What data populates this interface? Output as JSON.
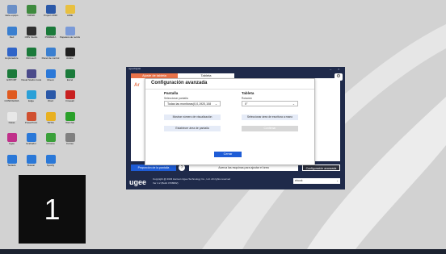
{
  "desktop": {
    "icons": [
      {
        "label": "Este equipo",
        "color": "#6a8fc7"
      },
      {
        "label": "XMIND",
        "color": "#3e8a3e"
      },
      {
        "label": "Project 2020",
        "color": "#2a58a8"
      },
      {
        "label": "AIDE",
        "color": "#e8c040"
      },
      {
        "label": "Red",
        "color": "#3a7fd0"
      },
      {
        "label": "OBS Studio",
        "color": "#303030"
      },
      {
        "label": "PRIMERA",
        "color": "#1a7a3a"
      },
      {
        "label": "Papelera de reciclaje",
        "color": "#7a9ad8"
      },
      {
        "label": "Exploradore",
        "color": "#2f64c8"
      },
      {
        "label": "Microsoft",
        "color": "#1a7a3a"
      },
      {
        "label": "Panel de control",
        "color": "#3a7fd0"
      },
      {
        "label": "Adobe",
        "color": "#202020"
      },
      {
        "label": "EXPORT",
        "color": "#1a7a3a"
      },
      {
        "label": "Visual Studio Code",
        "color": "#4a4a8a"
      },
      {
        "label": "Ubeon",
        "color": "#2a78d8"
      },
      {
        "label": "Excel",
        "color": "#1a7a3a"
      },
      {
        "label": "CONFIGURA",
        "color": "#e05a20"
      },
      {
        "label": "Edge",
        "color": "#2aa0d8"
      },
      {
        "label": "Word",
        "color": "#2a58a8"
      },
      {
        "label": "Firewall",
        "color": "#c82020"
      },
      {
        "label": "Notas",
        "color": "#e8e8e8"
      },
      {
        "label": "PowerPoint",
        "color": "#d05030"
      },
      {
        "label": "TikTok",
        "color": "#e8b020"
      },
      {
        "label": "WeChat",
        "color": "#2aa02a"
      },
      {
        "label": "Ugee",
        "color": "#c0308a"
      },
      {
        "label": "Grabador",
        "color": "#2a78d8"
      },
      {
        "label": "Chrome",
        "color": "#3aa03a"
      },
      {
        "label": "Correo",
        "color": "#808080"
      },
      {
        "label": "Teclado",
        "color": "#2a78d8"
      },
      {
        "label": "Buscar",
        "color": "#2a78d8"
      },
      {
        "label": "Spotify",
        "color": "#2a78d8"
      }
    ],
    "badge_number": "1"
  },
  "app": {
    "title": "ugeeDigital",
    "tab1": "Ajuste de tableta",
    "tab2": "Tableta",
    "panel_label": "Ar",
    "proportion_button": "Proporción de la pantalla",
    "help_icon": "?",
    "adapt_button": "Acerca las esquinas para ajustar el área",
    "advanced_button": "Configuración avanzada",
    "logo": "ugee",
    "copyright": "Copyright @ 2023 Hanvon Ugee Technology Co., Ltd. All rights reserved",
    "version": "Ver 4.2 (Build 4708082)",
    "language": "ebook",
    "colors": {
      "brand": "#1f2a4a",
      "accent": "#e8734a",
      "primary": "#1e5cd6"
    }
  },
  "modal": {
    "title": "Configuración avanzada",
    "screen": {
      "heading": "Pantalla",
      "select_label": "Seleccionar pantalla",
      "select_value": "Todas las monitoras(0,0,1920,108",
      "show_number_button": "Mostrar número de visualización",
      "set_area_button": "Establecer área de pantalla"
    },
    "tablet": {
      "heading": "Tableta",
      "rotation_label": "Rotación",
      "rotation_value": "0°",
      "select_area_button": "Seleccionar área de escritura a mano",
      "confirm_button": "Confirmar"
    },
    "close_button": "Cerrar"
  }
}
